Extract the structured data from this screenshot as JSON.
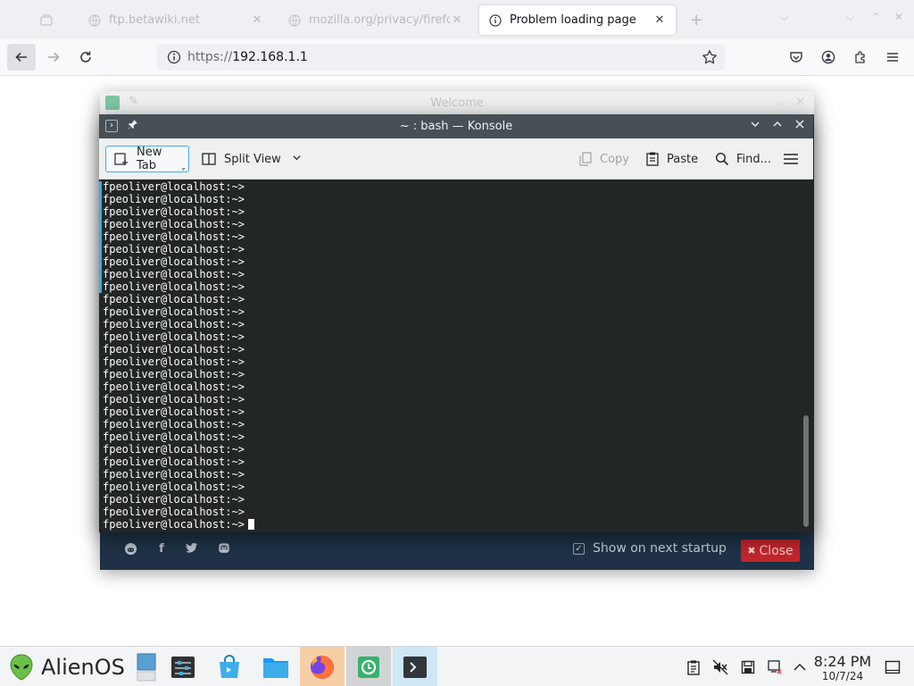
{
  "browser": {
    "tabs": [
      {
        "label": "ftp.betawiki.net",
        "active": false
      },
      {
        "label": "mozilla.org/privacy/firefox",
        "active": false
      },
      {
        "label": "Problem loading page",
        "active": true
      }
    ],
    "new_tab_symbol": "+",
    "url_protocol": "https://",
    "url_host": "192.168.1.1",
    "icons": [
      "back-icon",
      "forward-icon",
      "reload-icon",
      "info-icon",
      "bookmark-star-icon",
      "pocket-icon",
      "account-icon",
      "extensions-icon",
      "menu-icon"
    ]
  },
  "welcome_window": {
    "title": "Welcome",
    "show_on_startup_label": "Show on next startup",
    "close_label": "Close",
    "close_symbol": "✖",
    "social_icons": [
      "reddit-icon",
      "facebook-icon",
      "twitter-icon",
      "mastodon-icon"
    ]
  },
  "konsole": {
    "title": "~ : bash — Konsole",
    "toolbar": {
      "new_tab": "New Tab",
      "split_view": "Split View",
      "copy": "Copy",
      "paste": "Paste",
      "find": "Find..."
    },
    "prompt": "fpeoliver@localhost:~>",
    "prompt_line_count": 28
  },
  "taskbar": {
    "start_label": "AlienOS",
    "apps": [
      "desktop-icon",
      "system-settings-icon",
      "discover-store-icon",
      "file-manager-icon",
      "firefox-icon",
      "welcome-app-icon",
      "konsole-icon"
    ],
    "tray_icons": [
      "clipboard-icon",
      "volume-muted-icon",
      "storage-icon",
      "network-disconnected-icon",
      "tray-expand-icon",
      "show-desktop-icon"
    ],
    "clock_time": "8:24 PM",
    "clock_date": "10/7/24"
  },
  "colors": {
    "konsole_bg": "#232627",
    "konsole_titlebar": "#475057",
    "accent_blue": "#3daee9",
    "welcome_bg": "#1f3247",
    "close_red": "#c3262d",
    "firefox_active": "#f7cfa6"
  }
}
